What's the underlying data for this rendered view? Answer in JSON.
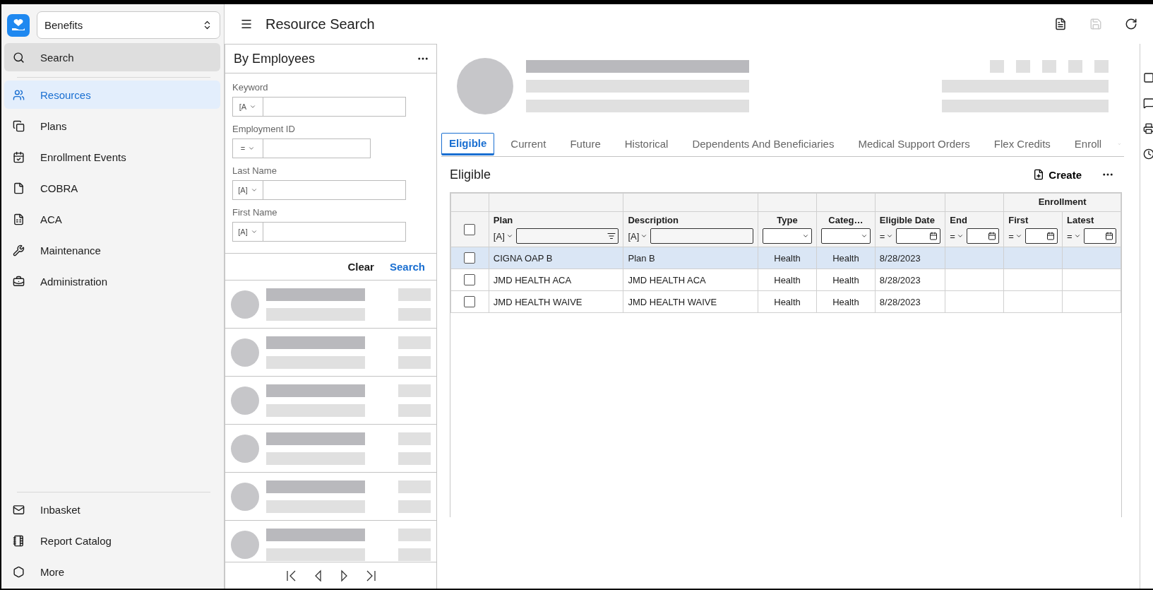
{
  "app": {
    "module": "Benefits"
  },
  "sidebar": {
    "search": {
      "label": "Search",
      "selected": false
    },
    "items": [
      {
        "label": "Resources",
        "selected": true
      },
      {
        "label": "Plans",
        "selected": false
      },
      {
        "label": "Enrollment Events",
        "selected": false
      },
      {
        "label": "COBRA",
        "selected": false
      },
      {
        "label": "ACA",
        "selected": false
      },
      {
        "label": "Maintenance",
        "selected": false
      },
      {
        "label": "Administration",
        "selected": false
      }
    ],
    "bottom_items": [
      {
        "label": "Inbasket",
        "selected": false
      },
      {
        "label": "Report Catalog",
        "selected": false
      },
      {
        "label": "More",
        "selected": false
      }
    ]
  },
  "header": {
    "title": "Resource Search",
    "toolbar": [
      {
        "kind": "pdf",
        "disabled": false
      },
      {
        "kind": "save",
        "disabled": true
      },
      {
        "kind": "refresh",
        "disabled": false
      }
    ]
  },
  "filter_panel": {
    "title": "By Employees",
    "fields": [
      {
        "label": "Keyword",
        "operator": "[A",
        "wide": true
      },
      {
        "label": "Employment ID",
        "operator": "=",
        "wide": false
      },
      {
        "label": "Last Name",
        "operator": "[A]",
        "wide": true
      },
      {
        "label": "First Name",
        "operator": "[A]",
        "wide": true
      }
    ],
    "buttons": [
      {
        "label": "Clear",
        "primary": false
      },
      {
        "label": "Search",
        "primary": true
      }
    ]
  },
  "tabs": [
    {
      "label": "Eligible",
      "selected": true
    },
    {
      "label": "Current",
      "selected": false
    },
    {
      "label": "Future",
      "selected": false
    },
    {
      "label": "Historical",
      "selected": false
    },
    {
      "label": "Dependents And Beneficiaries",
      "selected": false
    },
    {
      "label": "Medical Support Orders",
      "selected": false
    },
    {
      "label": "Flex Credits",
      "selected": false
    },
    {
      "label": "Enroll",
      "selected": false
    }
  ],
  "section": {
    "title": "Eligible",
    "action": "Create"
  },
  "table": {
    "group_header": "Enrollment",
    "select_all_checked": false,
    "columns": [
      {
        "label": "Plan",
        "kind": "text",
        "operator": "[A]",
        "search": true
      },
      {
        "label": "Description",
        "kind": "text",
        "operator": "[A]",
        "search": false
      },
      {
        "label": "Type",
        "kind": "select"
      },
      {
        "label": "Categ…",
        "kind": "select"
      },
      {
        "label": "Eligible Date",
        "kind": "date",
        "operator": "="
      },
      {
        "label": "End",
        "kind": "date",
        "operator": "="
      },
      {
        "label": "First",
        "kind": "date",
        "operator": "=",
        "group": true
      },
      {
        "label": "Latest",
        "kind": "date",
        "operator": "=",
        "group": true
      }
    ],
    "rows": [
      {
        "selected": true,
        "checked": false,
        "cells": [
          "CIGNA OAP B",
          "Plan B",
          "Health",
          "Health",
          "8/28/2023",
          "",
          "",
          ""
        ]
      },
      {
        "selected": false,
        "checked": false,
        "cells": [
          "JMD HEALTH ACA",
          "JMD HEALTH ACA",
          "Health",
          "Health",
          "8/28/2023",
          "",
          "",
          ""
        ]
      },
      {
        "selected": false,
        "checked": false,
        "cells": [
          "JMD HEALTH WAIVE",
          "JMD HEALTH WAIVE",
          "Health",
          "Health",
          "8/28/2023",
          "",
          "",
          ""
        ]
      }
    ]
  }
}
